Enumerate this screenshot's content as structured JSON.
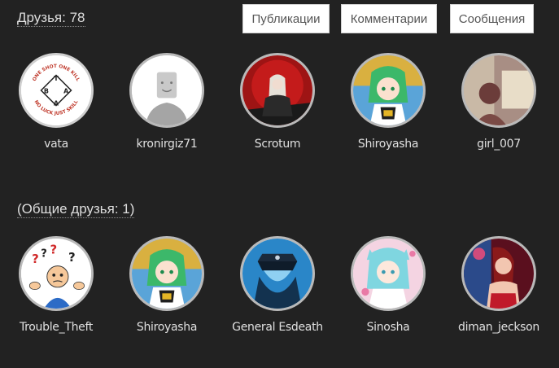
{
  "header": {
    "friends_label": "Друзья: 78",
    "tabs": [
      {
        "label": "Публикации"
      },
      {
        "label": "Комментарии"
      },
      {
        "label": "Сообщения"
      }
    ]
  },
  "friends": [
    {
      "name": "vata",
      "avatar_icon": "bta-logo-icon",
      "logo_text_top": "ONE SHOT ONE KILL",
      "logo_text_bottom": "NO LUCK JUST SKILL",
      "logo_letters": [
        "B",
        "T",
        "A",
        "A"
      ]
    },
    {
      "name": "kronirgiz71",
      "avatar_icon": "default-avatar-icon"
    },
    {
      "name": "Scrotum",
      "avatar_icon": "red-portrait-icon"
    },
    {
      "name": "Shiroyasha",
      "avatar_icon": "anime-girl-green-hair-icon"
    },
    {
      "name": "girl_007",
      "avatar_icon": "blurred-photo-icon"
    }
  ],
  "mutual": {
    "label": "(Общие друзья: 1)",
    "friends": [
      {
        "name": "Trouble_Theft",
        "avatar_icon": "confused-man-icon"
      },
      {
        "name": "Shiroyasha",
        "avatar_icon": "anime-girl-green-hair-icon"
      },
      {
        "name": "General Esdeath",
        "avatar_icon": "blue-uniform-icon"
      },
      {
        "name": "Sinosha",
        "avatar_icon": "anime-girl-cyan-hair-icon"
      },
      {
        "name": "diman_jeckson",
        "avatar_icon": "red-portrait-woman-icon"
      }
    ]
  },
  "colors": {
    "background": "#222222",
    "avatar_border": "#b9b9b9",
    "button_bg": "#ffffff"
  }
}
